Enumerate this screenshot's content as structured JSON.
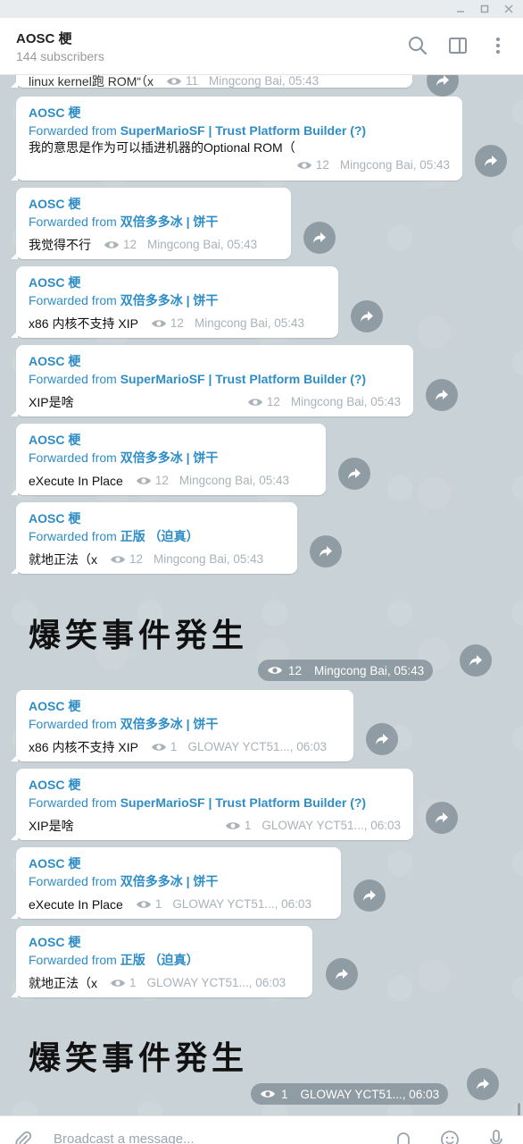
{
  "header": {
    "title": "AOSC 梗",
    "subtitle": "144 subscribers"
  },
  "top_partial": {
    "text": "linux kernel跑 ROM“（x",
    "views": "11",
    "author_time": "Mingcong Bai, 05:43"
  },
  "messages": [
    {
      "name": "AOSC 梗",
      "fwd_prefix": "Forwarded from ",
      "fwd_source": "SuperMarioSF | Trust Platform Builder (?)",
      "text": "我的意思是作为可以插进机器的Optional ROM（",
      "views": "12",
      "author_time": "Mingcong Bai, 05:43"
    },
    {
      "name": "AOSC 梗",
      "fwd_prefix": "Forwarded from ",
      "fwd_source": "双倍多多冰 | 饼干",
      "text": "我觉得不行",
      "views": "12",
      "author_time": "Mingcong Bai, 05:43"
    },
    {
      "name": "AOSC 梗",
      "fwd_prefix": "Forwarded from ",
      "fwd_source": "双倍多多冰 | 饼干",
      "text": "x86 内核不支持 XIP",
      "views": "12",
      "author_time": "Mingcong Bai, 05:43"
    },
    {
      "name": "AOSC 梗",
      "fwd_prefix": "Forwarded from ",
      "fwd_source": "SuperMarioSF | Trust Platform Builder (?)",
      "text": "XIP是啥",
      "views": "12",
      "author_time": "Mingcong Bai, 05:43"
    },
    {
      "name": "AOSC 梗",
      "fwd_prefix": "Forwarded from ",
      "fwd_source": "双倍多多冰 | 饼干",
      "text": "eXecute In Place",
      "views": "12",
      "author_time": "Mingcong Bai, 05:43"
    },
    {
      "name": "AOSC 梗",
      "fwd_prefix": "Forwarded from ",
      "fwd_source": "正版 （迫真）",
      "text": "就地正法（x",
      "views": "12",
      "author_time": "Mingcong Bai, 05:43"
    }
  ],
  "sticker1": {
    "text": "爆笑事件発生",
    "views": "12",
    "author_time": "Mingcong Bai, 05:43"
  },
  "messages2": [
    {
      "name": "AOSC 梗",
      "fwd_prefix": "Forwarded from ",
      "fwd_source": "双倍多多冰 | 饼干",
      "text": "x86 内核不支持 XIP",
      "views": "1",
      "author_time": "GLOWAY YCT51..., 06:03"
    },
    {
      "name": "AOSC 梗",
      "fwd_prefix": "Forwarded from ",
      "fwd_source": "SuperMarioSF | Trust Platform Builder (?)",
      "text": "XIP是啥",
      "views": "1",
      "author_time": "GLOWAY YCT51..., 06:03"
    },
    {
      "name": "AOSC 梗",
      "fwd_prefix": "Forwarded from ",
      "fwd_source": "双倍多多冰 | 饼干",
      "text": "eXecute In Place",
      "views": "1",
      "author_time": "GLOWAY YCT51..., 06:03"
    },
    {
      "name": "AOSC 梗",
      "fwd_prefix": "Forwarded from ",
      "fwd_source": "正版 （迫真）",
      "text": "就地正法（x",
      "views": "1",
      "author_time": "GLOWAY YCT51..., 06:03"
    }
  ],
  "sticker2": {
    "text": "爆笑事件発生",
    "views": "1",
    "author_time": "GLOWAY YCT51..., 06:03"
  },
  "input": {
    "placeholder": "Broadcast a message..."
  },
  "colors": {
    "accent": "#2f8dc6",
    "chat_bg": "#c9d2d6"
  }
}
